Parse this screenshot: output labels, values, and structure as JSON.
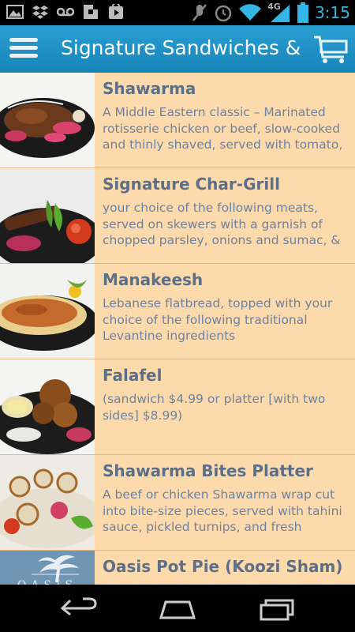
{
  "status_bar": {
    "time": "3:15",
    "network_label": "4G",
    "left_icons": [
      "image-icon",
      "dropbox-icon",
      "voicemail-icon",
      "flipboard-icon",
      "play-store-icon"
    ],
    "right_icons": [
      "mute-icon",
      "alarm-icon",
      "wifi-icon",
      "signal-icon",
      "battery-icon"
    ]
  },
  "action_bar": {
    "title": "Signature Sandwiches &",
    "menu_icon": "hamburger-menu-icon",
    "cart_icon": "shopping-cart-icon"
  },
  "menu_items": [
    {
      "name": "Shawarma",
      "description": "A Middle Eastern classic – Marinated rotisserie chicken or beef, slow-cooked and thinly shaved, served with tomato,"
    },
    {
      "name": "Signature Char-Grill",
      "description": "your choice of the following meats, served on skewers with a garnish of chopped parsley, onions and sumac, &"
    },
    {
      "name": "Manakeesh",
      "description": " Lebanese flatbread, topped with your choice of the following traditional Levantine ingredients"
    },
    {
      "name": "Falafel",
      "description": " (sandwich $4.99 or platter [with two sides] $8.99)"
    },
    {
      "name": "Shawarma Bites Platter",
      "description": "A beef or chicken Shawarma wrap cut into bite-size pieces, served with tahini sauce, pickled turnips, and fresh"
    },
    {
      "name": "Oasis Pot Pie (Koozi Sham)",
      "description": ""
    }
  ],
  "colors": {
    "action_bar": "#1d93c7",
    "list_background": "#fcdaab",
    "item_title": "#5c6f88",
    "item_text": "#6e82a0",
    "status_accent": "#33b5e5"
  },
  "nav_bar": {
    "buttons": [
      "back-icon",
      "home-icon",
      "recent-apps-icon"
    ]
  }
}
